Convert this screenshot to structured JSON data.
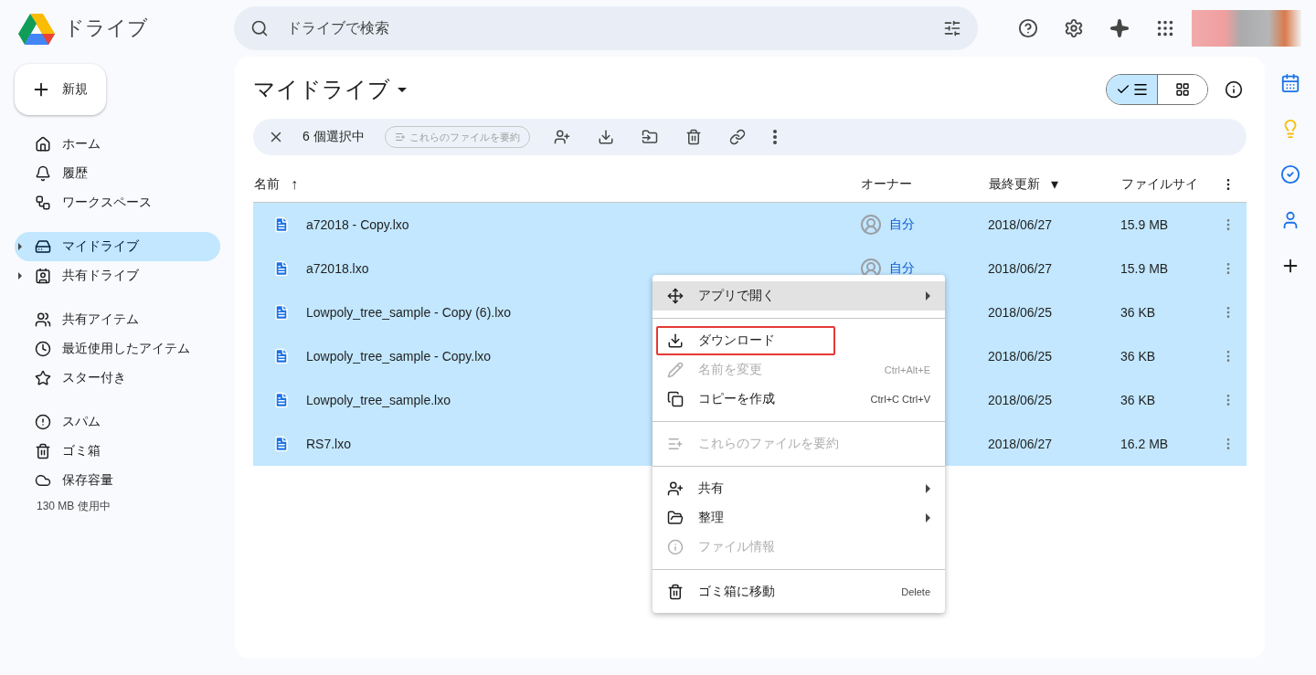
{
  "app": {
    "title": "ドライブ"
  },
  "search": {
    "placeholder": "ドライブで検索"
  },
  "new_button": {
    "label": "新規"
  },
  "sidebar": {
    "groups": [
      [
        {
          "label": "ホーム",
          "selected": false,
          "expandable": false
        },
        {
          "label": "履歴",
          "selected": false,
          "expandable": false
        },
        {
          "label": "ワークスペース",
          "selected": false,
          "expandable": false
        }
      ],
      [
        {
          "label": "マイドライブ",
          "selected": true,
          "expandable": true
        },
        {
          "label": "共有ドライブ",
          "selected": false,
          "expandable": true
        }
      ],
      [
        {
          "label": "共有アイテム",
          "selected": false,
          "expandable": false
        },
        {
          "label": "最近使用したアイテム",
          "selected": false,
          "expandable": false
        },
        {
          "label": "スター付き",
          "selected": false,
          "expandable": false
        }
      ],
      [
        {
          "label": "スパム",
          "selected": false,
          "expandable": false
        },
        {
          "label": "ゴミ箱",
          "selected": false,
          "expandable": false
        },
        {
          "label": "保存容量",
          "selected": false,
          "expandable": false
        }
      ]
    ],
    "storage": "130 MB 使用中"
  },
  "page": {
    "title": "マイドライブ"
  },
  "views": [
    {
      "kind": "list",
      "selected": true
    },
    {
      "kind": "grid",
      "selected": false
    }
  ],
  "selection_bar": {
    "count": "6 個選択中",
    "summarize": "これらのファイルを要約"
  },
  "table": {
    "columns": [
      {
        "label": "名前",
        "sort_icon": "↑"
      },
      {
        "label": "オーナー"
      },
      {
        "label": "最終更新",
        "sort_icon": "▾"
      },
      {
        "label": "ファイルサイ"
      }
    ],
    "rows": [
      {
        "name": "a72018 - Copy.lxo",
        "owner": "自分",
        "modified": "2018/06/27",
        "size": "15.9 MB",
        "selected": true
      },
      {
        "name": "a72018.lxo",
        "owner": "自分",
        "modified": "2018/06/27",
        "size": "15.9 MB",
        "selected": true
      },
      {
        "name": "Lowpoly_tree_sample - Copy (6).lxo",
        "modified": "2018/06/25",
        "size": "36 KB",
        "selected": true
      },
      {
        "name": "Lowpoly_tree_sample - Copy.lxo",
        "modified": "2018/06/25",
        "size": "36 KB",
        "selected": true
      },
      {
        "name": "Lowpoly_tree_sample.lxo",
        "modified": "2018/06/25",
        "size": "36 KB",
        "selected": true
      },
      {
        "name": "RS7.lxo",
        "modified": "2018/06/27",
        "size": "16.2 MB",
        "selected": true
      }
    ]
  },
  "context_menu": {
    "groups": [
      [
        {
          "label": "アプリで開く",
          "disabled": false,
          "submenu": true,
          "hovered": true,
          "highlighted": false
        }
      ],
      [
        {
          "label": "ダウンロード",
          "disabled": false,
          "submenu": false,
          "hovered": false,
          "highlighted": true
        },
        {
          "label": "名前を変更",
          "shortcut": "Ctrl+Alt+E",
          "disabled": true,
          "submenu": false,
          "hovered": false,
          "highlighted": false
        },
        {
          "label": "コピーを作成",
          "shortcut": "Ctrl+C Ctrl+V",
          "disabled": false,
          "submenu": false,
          "hovered": false,
          "highlighted": false
        }
      ],
      [
        {
          "label": "これらのファイルを要約",
          "disabled": true,
          "submenu": false,
          "hovered": false,
          "highlighted": false
        }
      ],
      [
        {
          "label": "共有",
          "disabled": false,
          "submenu": true,
          "hovered": false,
          "highlighted": false
        },
        {
          "label": "整理",
          "disabled": false,
          "submenu": true,
          "hovered": false,
          "highlighted": false
        },
        {
          "label": "ファイル情報",
          "disabled": true,
          "submenu": false,
          "hovered": false,
          "highlighted": false
        }
      ],
      [
        {
          "label": "ゴミ箱に移動",
          "shortcut": "Delete",
          "disabled": false,
          "submenu": false,
          "hovered": false,
          "highlighted": false
        }
      ]
    ]
  }
}
